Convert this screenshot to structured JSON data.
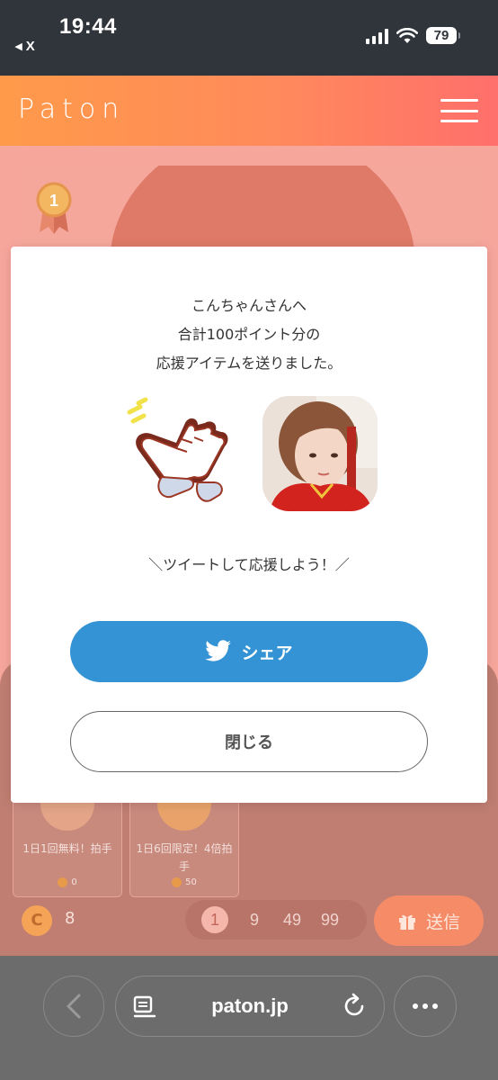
{
  "status_bar": {
    "time": "19:44",
    "back_label": "◂ X",
    "battery": "79"
  },
  "header": {
    "logo": "Paton"
  },
  "rank": {
    "number": "1"
  },
  "items": [
    {
      "label": "1日1回無料！拍手",
      "cost": "0"
    },
    {
      "label": "1日6回限定！4倍拍手",
      "cost": "50"
    }
  ],
  "footer": {
    "coin_symbol": "C",
    "coin_count": "8",
    "quantities": [
      "1",
      "9",
      "49",
      "99"
    ],
    "selected_quantity": "1",
    "send_label": "送信"
  },
  "modal": {
    "line1": "こんちゃんさんへ",
    "line2": "合計100ポイント分の",
    "line3": "応援アイテムを送りました。",
    "prompt": "＼ツイートして応援しよう！／",
    "share_label": "シェア",
    "close_label": "閉じる"
  },
  "browser": {
    "url": "paton.jp"
  },
  "colors": {
    "header_start": "#ff9a4a",
    "header_end": "#ff6f6c",
    "share": "#3393d4",
    "send": "#f58b67"
  }
}
